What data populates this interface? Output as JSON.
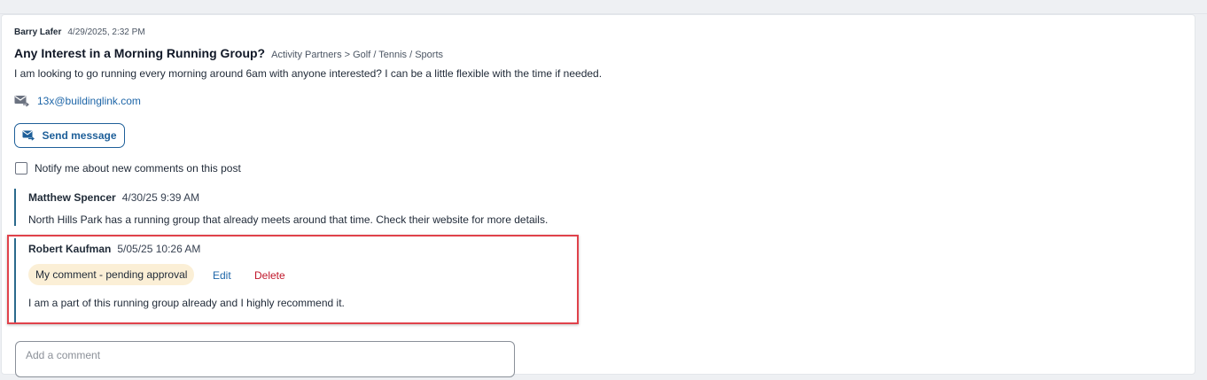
{
  "post": {
    "author": "Barry Lafer",
    "date": "4/29/2025, 2:32 PM",
    "title": "Any Interest in a Morning Running Group?",
    "category": "Activity Partners > Golf / Tennis / Sports",
    "body": "I am looking to go running every morning around 6am with anyone interested? I can be a little flexible with the time if needed.",
    "email": "13x@buildinglink.com",
    "email_icon": "mail-icon",
    "send_label": "Send message",
    "send_icon": "send-message-icon",
    "notify_label": "Notify me about new comments on this post"
  },
  "comments": [
    {
      "name": "Matthew Spencer",
      "date": "4/30/25 9:39 AM",
      "text": "North Hills Park has a running group that already meets around that time. Check their website for more details."
    },
    {
      "name": "Robert Kaufman",
      "date": "5/05/25 10:26 AM",
      "status": "My comment - pending approval",
      "edit_label": "Edit",
      "delete_label": "Delete",
      "text": "I am a part of this running group already and I highly recommend it."
    }
  ],
  "new_comment": {
    "placeholder": "Add a comment",
    "value": ""
  },
  "colors": {
    "link": "#1e66a8",
    "delete": "#c0172a",
    "pending_bg": "#fbefd6",
    "highlight": "#e0424b",
    "thread_bar": "#2b6a8c"
  }
}
